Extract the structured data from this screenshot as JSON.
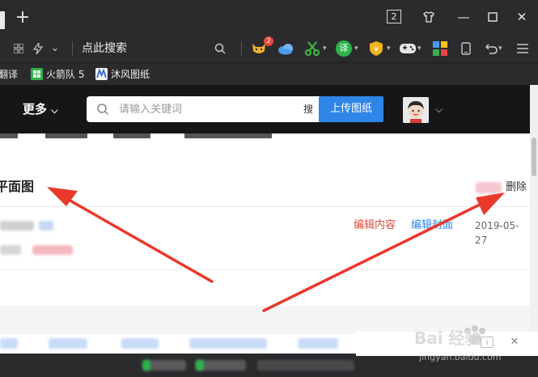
{
  "browser": {
    "tab_count": "2",
    "address_text": "点此搜索",
    "extension_badge": "2",
    "ext_translate_label": "译",
    "bookmarks": [
      {
        "label": "翻译"
      },
      {
        "label": "火箭队 5"
      },
      {
        "label": "沐风图纸"
      }
    ]
  },
  "site_header": {
    "more_label": "更多",
    "search_placeholder": "请输入关键词",
    "search_button_label": "搜",
    "upload_label": "上传图纸"
  },
  "item": {
    "title": "平面图",
    "delete_label": "删除",
    "edit_content_label": "编辑内容",
    "edit_cover_label": "编辑封面",
    "date": "2019-05-27"
  },
  "watermark": {
    "line1": "Bai 经验",
    "line2": "jingyan.baidu.com"
  },
  "colors": {
    "chrome_bg": "#2b2b2e",
    "header_bg": "#161618",
    "upload_button": "#2f86e8",
    "edit_content": "#e04b3c",
    "edit_cover": "#2f86e8",
    "annotation_arrow": "#e8392b"
  },
  "icons": {
    "new_tab": "plus-icon",
    "window": [
      "tab-count-icon",
      "shirt-skin-icon",
      "minimize-icon",
      "maximize-icon",
      "close-icon"
    ],
    "toolbar": [
      "apps-grid-icon",
      "lightning-icon",
      "chevron-down-icon",
      "search-icon",
      "cat-extension-icon",
      "cloud-icon",
      "scissors-icon",
      "translate-icon",
      "shield-icon",
      "gamepad-icon",
      "app-tiles-icon",
      "phone-icon",
      "undo-icon",
      "menu-icon"
    ]
  }
}
